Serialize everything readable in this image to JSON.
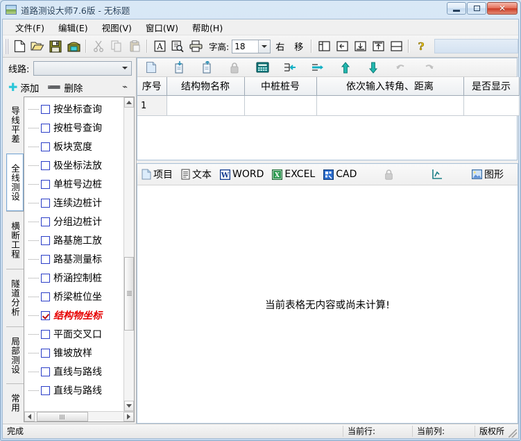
{
  "window": {
    "title": "道路测设大师7.6版 - 无标题",
    "icon": "road-app-icon",
    "buttons": {
      "minimize": "minimize-button",
      "maximize": "maximize-button",
      "close": "✕"
    }
  },
  "menubar": {
    "items": [
      {
        "label": "文件(F)",
        "name": "menu-file"
      },
      {
        "label": "编辑(E)",
        "name": "menu-edit"
      },
      {
        "label": "视图(V)",
        "name": "menu-view"
      },
      {
        "label": "窗口(W)",
        "name": "menu-window"
      },
      {
        "label": "帮助(H)",
        "name": "menu-help"
      }
    ]
  },
  "toolbar": {
    "icons_left": [
      {
        "name": "new-file-icon"
      },
      {
        "name": "open-folder-icon"
      },
      {
        "name": "save-disk-icon"
      },
      {
        "name": "save-as-icon"
      },
      {
        "name": "cut-icon"
      },
      {
        "name": "copy-icon"
      },
      {
        "name": "paste-icon"
      },
      {
        "name": "font-icon"
      },
      {
        "name": "print-preview-icon"
      },
      {
        "name": "print-icon"
      }
    ],
    "font_height_label": "字高:",
    "font_height_value": "18",
    "right_label": "右",
    "move_label": "移",
    "window_layout_icons": [
      {
        "name": "split-vertical-icon"
      },
      {
        "name": "dock-left-icon"
      },
      {
        "name": "dock-bottom-icon"
      },
      {
        "name": "dock-top-icon"
      },
      {
        "name": "split-horizontal-icon"
      }
    ],
    "help_icon": "help-question-icon"
  },
  "leftpanel": {
    "route_label": "线路:",
    "route_value": "",
    "add_label": "添加",
    "delete_label": "删除",
    "pin_icon": "pin-icon",
    "vtabs": [
      {
        "label": "导线平差",
        "active": false
      },
      {
        "label": "全线测设",
        "active": true
      },
      {
        "label": "横断工程",
        "active": false
      },
      {
        "label": "隧道分析",
        "active": false
      },
      {
        "label": "局部测设",
        "active": false
      },
      {
        "label": "常用",
        "active": false
      }
    ],
    "tree_items": [
      {
        "label": "按坐标查询",
        "checked": false,
        "selected": false
      },
      {
        "label": "按桩号查询",
        "checked": false,
        "selected": false
      },
      {
        "label": "板块宽度",
        "checked": false,
        "selected": false
      },
      {
        "label": "极坐标法放",
        "checked": false,
        "selected": false
      },
      {
        "label": "单桩号边桩",
        "checked": false,
        "selected": false
      },
      {
        "label": "连续边桩计",
        "checked": false,
        "selected": false
      },
      {
        "label": "分组边桩计",
        "checked": false,
        "selected": false
      },
      {
        "label": "路基施工放",
        "checked": false,
        "selected": false
      },
      {
        "label": "路基测量标",
        "checked": false,
        "selected": false
      },
      {
        "label": "桥涵控制桩",
        "checked": false,
        "selected": false
      },
      {
        "label": "桥梁桩位坐",
        "checked": false,
        "selected": false
      },
      {
        "label": "结构物坐标",
        "checked": true,
        "selected": true
      },
      {
        "label": "平面交叉口",
        "checked": false,
        "selected": false
      },
      {
        "label": "锥坡放样",
        "checked": false,
        "selected": false
      },
      {
        "label": "直线与路线",
        "checked": false,
        "selected": false
      },
      {
        "label": "直线与路线",
        "checked": false,
        "selected": false
      }
    ]
  },
  "grid": {
    "toolbar_icons": [
      {
        "name": "new-record-icon"
      },
      {
        "name": "import-icon"
      },
      {
        "name": "export-icon"
      },
      {
        "name": "lock-icon"
      },
      {
        "name": "calculator-icon"
      },
      {
        "name": "insert-row-icon"
      },
      {
        "name": "append-row-icon"
      },
      {
        "name": "move-up-icon"
      },
      {
        "name": "move-down-icon"
      },
      {
        "name": "undo-icon"
      },
      {
        "name": "redo-icon"
      }
    ],
    "columns": [
      "序号",
      "结构物名称",
      "中桩桩号",
      "依次输入转角、距离",
      "是否显示"
    ],
    "rows": [
      {
        "cells": [
          "1",
          "",
          "",
          "",
          ""
        ]
      }
    ]
  },
  "output": {
    "buttons": [
      {
        "label": "项目",
        "icon": "project-icon"
      },
      {
        "label": "文本",
        "icon": "text-document-icon"
      },
      {
        "label": "WORD",
        "icon": "word-icon"
      },
      {
        "label": "EXCEL",
        "icon": "excel-icon"
      },
      {
        "label": "CAD",
        "icon": "cad-icon"
      }
    ],
    "tail_icons": [
      {
        "name": "lock-icon"
      },
      {
        "name": "chart-axes-icon"
      }
    ],
    "graphic_button": {
      "label": "图形",
      "icon": "picture-icon"
    },
    "empty_message": "当前表格无内容或尚未计算!"
  },
  "statusbar": {
    "state": "完成",
    "current_row_label": "当前行:",
    "current_col_label": "当前列:",
    "copyright_label": "版权所"
  }
}
